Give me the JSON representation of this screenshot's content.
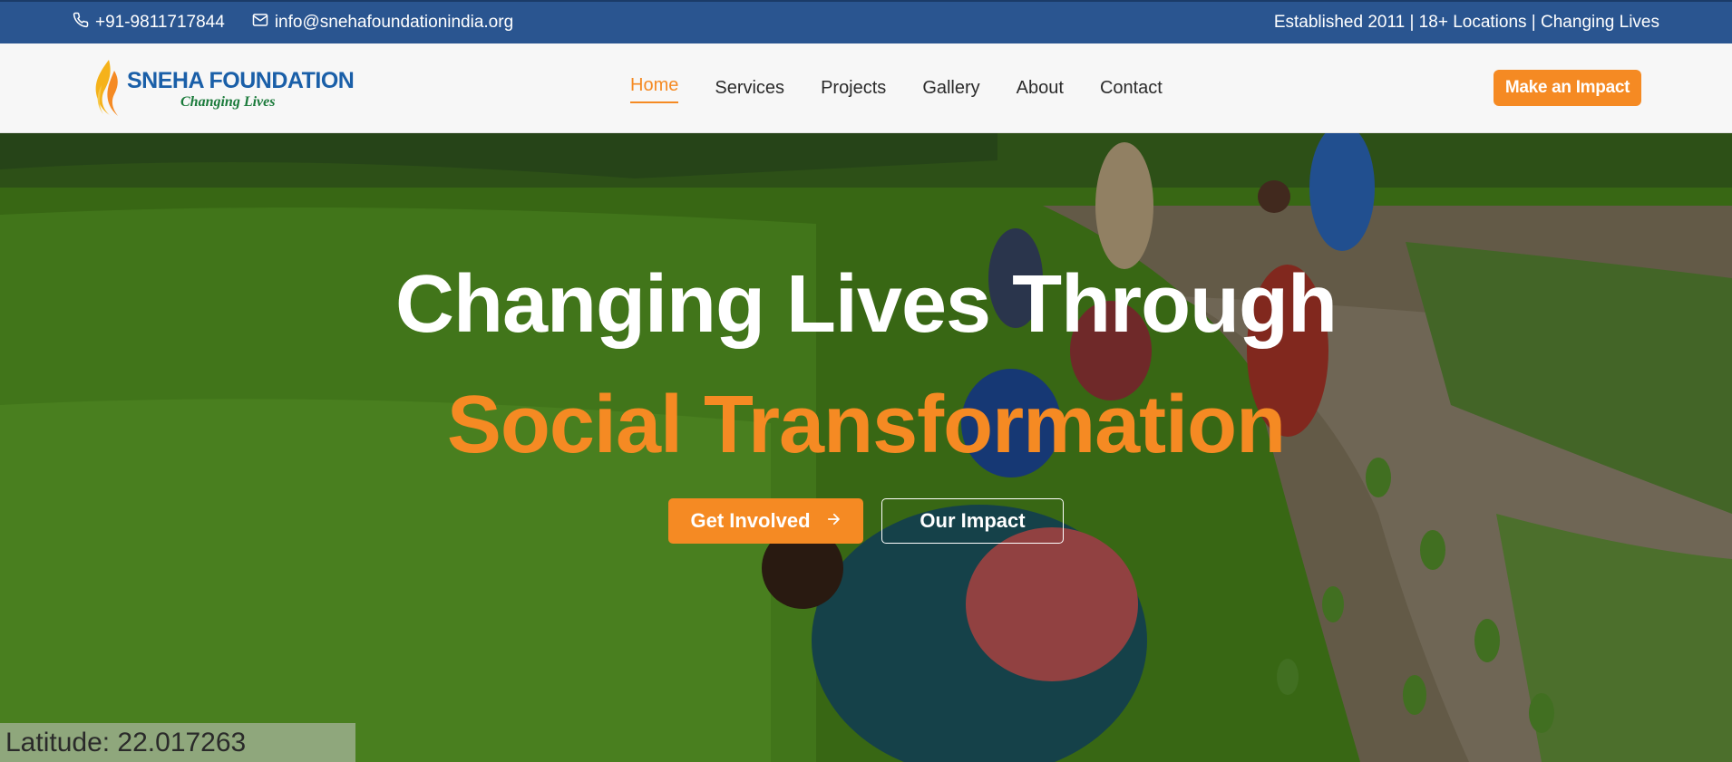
{
  "topbar": {
    "phone": "+91-9811717844",
    "email": "info@snehafoundationindia.org",
    "tagline": "Established 2011 | 18+ Locations | Changing Lives"
  },
  "header": {
    "logo": {
      "brand": "SNEHA FOUNDATION",
      "slogan": "Changing Lives"
    },
    "nav": [
      "Home",
      "Services",
      "Projects",
      "Gallery",
      "About",
      "Contact"
    ],
    "active_nav": "Home",
    "cta": "Make an Impact"
  },
  "hero": {
    "title_line1": "Changing Lives Through",
    "title_line2": "Social Transformation",
    "primary_button": "Get Involved",
    "secondary_button": "Our Impact",
    "location_readout": "Latitude: 22.017263"
  },
  "colors": {
    "accent": "#f58a23",
    "topbar": "#2a5590",
    "brand_blue": "#1a5fa8",
    "slogan_green": "#1a7a3a"
  },
  "icons": {
    "phone": "phone-icon",
    "email": "mail-icon",
    "arrow": "arrow-right-icon",
    "logo": "flame-logo-icon"
  }
}
